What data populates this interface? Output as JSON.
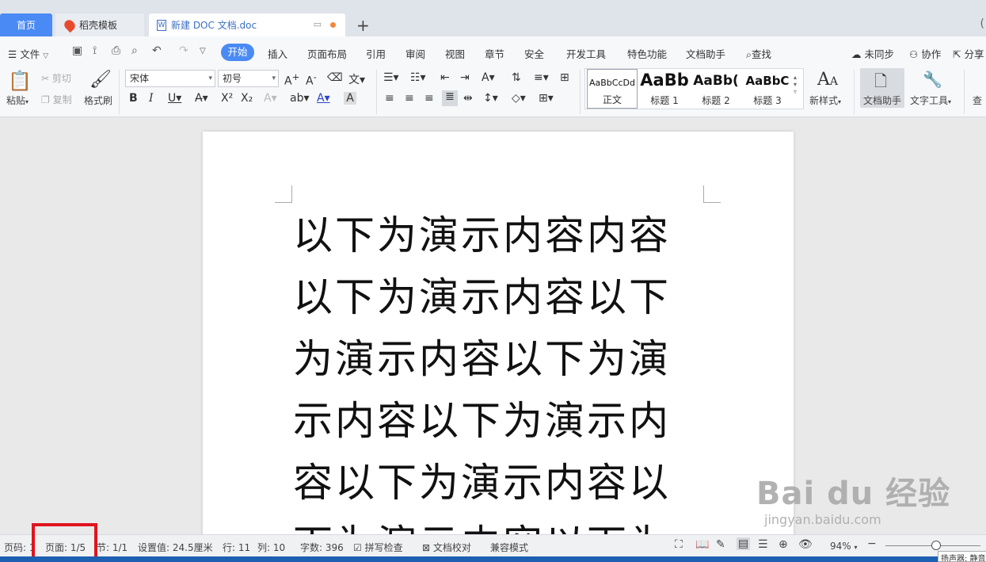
{
  "tabs": {
    "home": "首页",
    "daoke": "稻壳模板",
    "doc": "新建 DOC 文档.doc",
    "plus": "+"
  },
  "menu": {
    "file": "文件",
    "items": [
      "开始",
      "插入",
      "页面布局",
      "引用",
      "审阅",
      "视图",
      "章节",
      "安全",
      "开发工具",
      "特色功能",
      "文档助手",
      "查找"
    ],
    "right": [
      "未同步",
      "协作",
      "分享"
    ]
  },
  "ribbon": {
    "paste": "粘贴",
    "cut": "剪切",
    "copy": "复制",
    "format_painter": "格式刷",
    "font_name": "宋体",
    "font_size": "初号",
    "styles": [
      {
        "sample": "AaBbCcDd",
        "name": "正文"
      },
      {
        "sample": "AaBb",
        "name": "标题 1"
      },
      {
        "sample": "AaBb(",
        "name": "标题 2"
      },
      {
        "sample": "AaBbC",
        "name": "标题 3"
      }
    ],
    "new_style": "新样式",
    "doc_assistant": "文档助手",
    "text_tools": "文字工具",
    "find_cut": "查"
  },
  "document": {
    "lines": [
      "以下为演示内容内容",
      "以下为演示内容以下",
      "为演示内容以下为演",
      "示内容以下为演示内",
      "容以下为演示内容以",
      "下为演示内容以下为"
    ]
  },
  "status": {
    "page_code": "页码: 1",
    "page": "页面: 1/5",
    "section": "节: 1/1",
    "setting": "设置值: 24.5厘米",
    "row": "行: 11",
    "col": "列: 10",
    "word_count": "字数: 396",
    "spell_check": "拼写检查",
    "doc_proof": "文档校对",
    "compat_mode": "兼容模式",
    "zoom": "94%",
    "tooltip": "扬声器: 静音"
  },
  "watermark": {
    "big": "Bai du 经验",
    "small": "jingyan.baidu.com"
  },
  "colors": {
    "accent": "#4a8af4",
    "highlight": "#e0141e"
  }
}
